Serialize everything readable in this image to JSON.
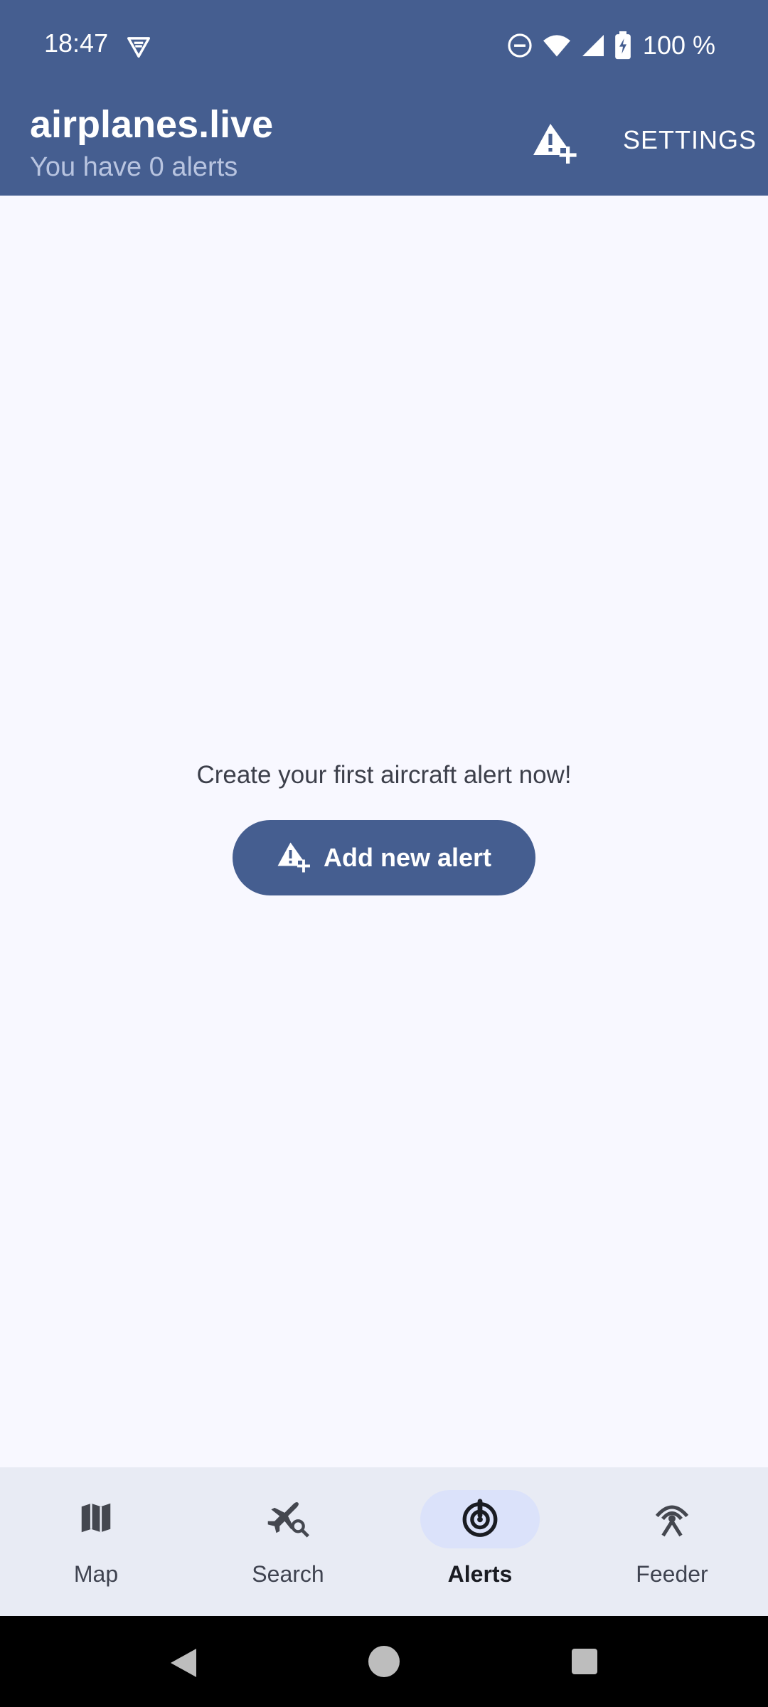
{
  "status_bar": {
    "time": "18:47",
    "battery_text": "100 %",
    "icons": [
      "vpn-icon",
      "do-not-disturb-icon",
      "wifi-icon",
      "cell-signal-icon",
      "battery-charging-icon"
    ]
  },
  "app_bar": {
    "title": "airplanes.live",
    "subtitle": "You have 0 alerts",
    "add_alert_icon": "alert-add-icon",
    "settings_label": "SETTINGS",
    "background_color": "#455e90"
  },
  "empty_state": {
    "message": "Create your first aircraft alert now!",
    "button_label": "Add new alert",
    "button_icon": "alert-add-icon"
  },
  "bottom_nav": {
    "items": [
      {
        "label": "Map",
        "icon": "map-icon",
        "active": false
      },
      {
        "label": "Search",
        "icon": "flight-search-icon",
        "active": false
      },
      {
        "label": "Alerts",
        "icon": "alerts-radar-icon",
        "active": true
      },
      {
        "label": "Feeder",
        "icon": "antenna-icon",
        "active": false
      }
    ]
  },
  "system_nav": {
    "buttons": [
      "back-icon",
      "home-icon",
      "recents-icon"
    ]
  }
}
